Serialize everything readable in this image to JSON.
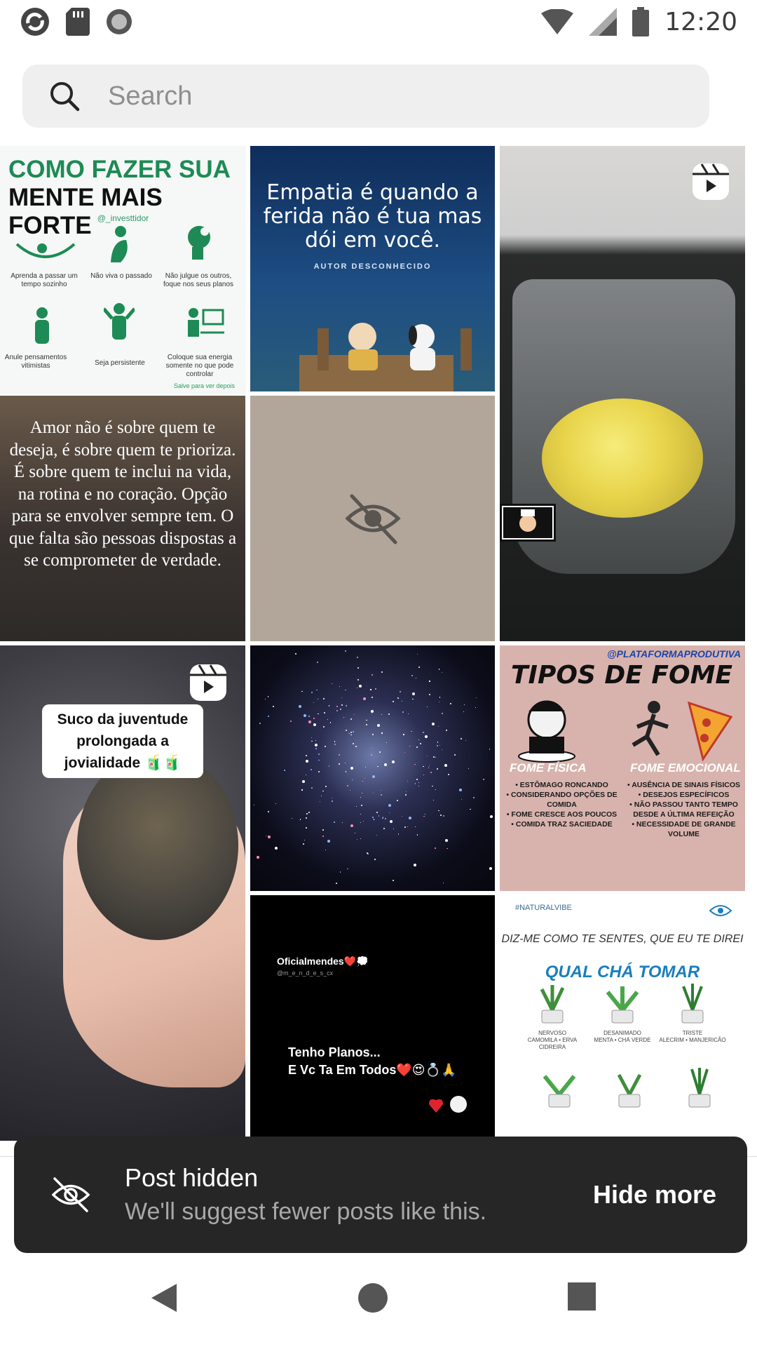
{
  "status_bar": {
    "time": "12:20",
    "left_icons": [
      "sync-app-icon",
      "sd-card-icon",
      "record-icon"
    ],
    "right_icons": [
      "wifi-icon",
      "cell-signal-icon",
      "battery-icon"
    ]
  },
  "search": {
    "placeholder": "Search",
    "value": ""
  },
  "tiles": {
    "t1": {
      "title_green": "COMO FAZER SUA",
      "title_black": "MENTE MAIS FORTE",
      "handle": "@_investtidor",
      "items": [
        "Aprenda a passar um tempo sozinho",
        "Não viva o passado",
        "Não julgue os outros, foque nos seus planos",
        "Anule pensamentos vitimistas",
        "Seja persistente",
        "Coloque sua energia somente no que pode controlar"
      ],
      "footer": "Salve para ver depois"
    },
    "t2": {
      "quote": "Empatia é quando a ferida não é tua mas dói em você.",
      "author": "AUTOR DESCONHECIDO"
    },
    "t4": {
      "quote": "Amor não é sobre quem te deseja, é sobre quem te prioriza. É sobre quem te inclui na vida, na rotina e no coração. Opção para se envolver sempre tem. O que falta são pessoas dispostas a se comprometer de verdade."
    },
    "t6": {
      "caption": "Suco da juventude prolongada a jovialidade 🧃🧃"
    },
    "t8": {
      "handle": "@PLATAFORMAPRODUTIVA",
      "title": "TIPOS DE FOME",
      "col1_title": "FOME FÍSICA",
      "col1_items": "• ESTÔMAGO RONCANDO\n• CONSIDERANDO OPÇÕES DE COMIDA\n• FOME CRESCE AOS POUCOS\n• COMIDA TRAZ SACIEDADE",
      "col2_title": "FOME EMOCIONAL",
      "col2_items": "• AUSÊNCIA DE SINAIS FÍSICOS\n• DESEJOS ESPECÍFICOS\n• NÃO PASSOU TANTO TEMPO DESDE A ÚLTIMA REFEIÇÃO\n• NECESSIDADE DE GRANDE VOLUME"
    },
    "t9": {
      "user": "Oficialmendes❤️💭",
      "subuser": "@m_e_n_d_e_s_cx",
      "text": "Tenho Planos...\nE Vc Ta Em Todos❤️😍💍🙏"
    },
    "t10": {
      "tag": "#NATURALVIBE",
      "line1": "DIZ-ME COMO TE SENTES, QUE EU TE DIREI",
      "line2": "QUAL CHÁ TOMAR",
      "plants": [
        "NERVOSO\nCAMOMILA • ERVA CIDREIRA",
        "DESANIMADO\nMENTA • CHÁ VERDE",
        "TRISTE\nALECRIM • MANJERICÃO"
      ]
    }
  },
  "snackbar": {
    "title": "Post hidden",
    "subtitle": "We'll suggest fewer posts like this.",
    "action": "Hide more"
  },
  "colors": {
    "snackbar_bg": "#262626",
    "search_bg": "#efefef",
    "hidden_tile_bg": "#b2a69a"
  }
}
